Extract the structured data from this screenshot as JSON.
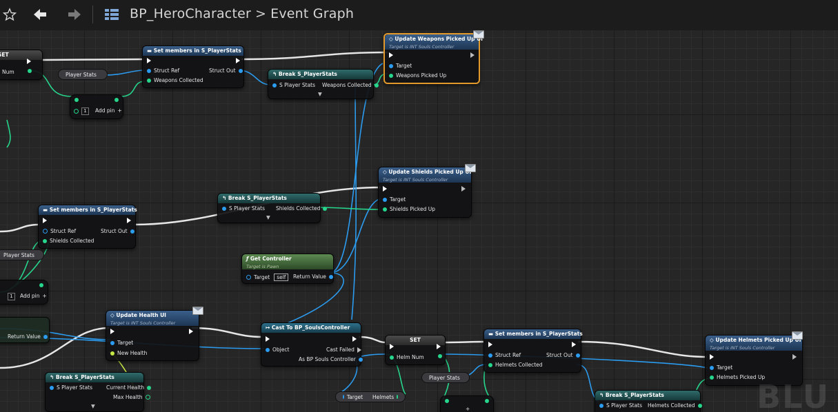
{
  "toolbar": {
    "favorite_icon": "star-icon",
    "back_icon": "arrow-left-icon",
    "forward_icon": "arrow-right-icon",
    "graph_icon": "blueprint-grid-icon",
    "breadcrumb_root": "BP_HeroCharacter",
    "breadcrumb_sep": ">",
    "breadcrumb_current": "Event Graph"
  },
  "nodes": {
    "set_top": {
      "title": "SET",
      "pin_num": "Num"
    },
    "set_members_1": {
      "title": "Set members in S_PlayerStats",
      "struct_ref": "Struct Ref",
      "struct_out": "Struct Out",
      "weapons": "Weapons Collected"
    },
    "player_stats_var_1": "Player Stats",
    "add_pin_1": {
      "index": "1",
      "label": "Add pin"
    },
    "break_1": {
      "title": "Break S_PlayerStats",
      "in": "S Player Stats",
      "out": "Weapons Collected"
    },
    "update_weapons": {
      "title": "Update Weapons Picked Up UI",
      "subtitle": "Target is INT Souls Controller",
      "target": "Target",
      "param": "Weapons Picked Up"
    },
    "update_shields": {
      "title": "Update Shields Picked Up UI",
      "subtitle": "Target is INT Souls Controller",
      "target": "Target",
      "param": "Shields Picked Up"
    },
    "break_2": {
      "title": "Break S_PlayerStats",
      "in": "S Player Stats",
      "out": "Shields Collected"
    },
    "set_members_2": {
      "title": "Set members in S_PlayerStats",
      "struct_ref": "Struct Ref",
      "struct_out": "Struct Out",
      "shields": "Shields Collected"
    },
    "player_stats_var_2": "Player Stats",
    "add_pin_2": {
      "index": "1",
      "label": "Add pin"
    },
    "get_controller": {
      "title": "Get Controller",
      "subtitle": "Target is Pawn",
      "target": "Target",
      "self": "self",
      "ret": "Return Value"
    },
    "left_return": "Return Value",
    "update_health": {
      "title": "Update Health UI",
      "subtitle": "Target is INT Souls Controller",
      "target": "Target",
      "param": "New Health"
    },
    "break_3": {
      "title": "Break S_PlayerStats",
      "in": "S Player Stats",
      "out1": "Current Health",
      "out2": "Max Health"
    },
    "cast": {
      "title": "Cast To BP_SoulsController",
      "object": "Object",
      "failed": "Cast Failed",
      "as": "As BP Souls Controller"
    },
    "set_helm": {
      "title": "SET",
      "pin": "Helm Num"
    },
    "target_helmets": {
      "target": "Target",
      "helmets": "Helmets"
    },
    "player_stats_var_3": "Player Stats",
    "set_members_3": {
      "title": "Set members in S_PlayerStats",
      "struct_ref": "Struct Ref",
      "struct_out": "Struct Out",
      "helmets": "Helmets Collected"
    },
    "break_4": {
      "title": "Break S_PlayerStats",
      "in": "S Player Stats",
      "out": "Helmets Collected"
    },
    "update_helmets": {
      "title": "Update Helmets Picked Up UI",
      "subtitle": "Target is INT Souls Controller",
      "target": "Target",
      "param": "Helmets Picked Up"
    }
  },
  "watermark": "BLU",
  "colors": {
    "exec": "#ffffff",
    "struct_pin": "#2b9cf0",
    "int_pin": "#26d68c",
    "selection": "#e39a2b"
  }
}
